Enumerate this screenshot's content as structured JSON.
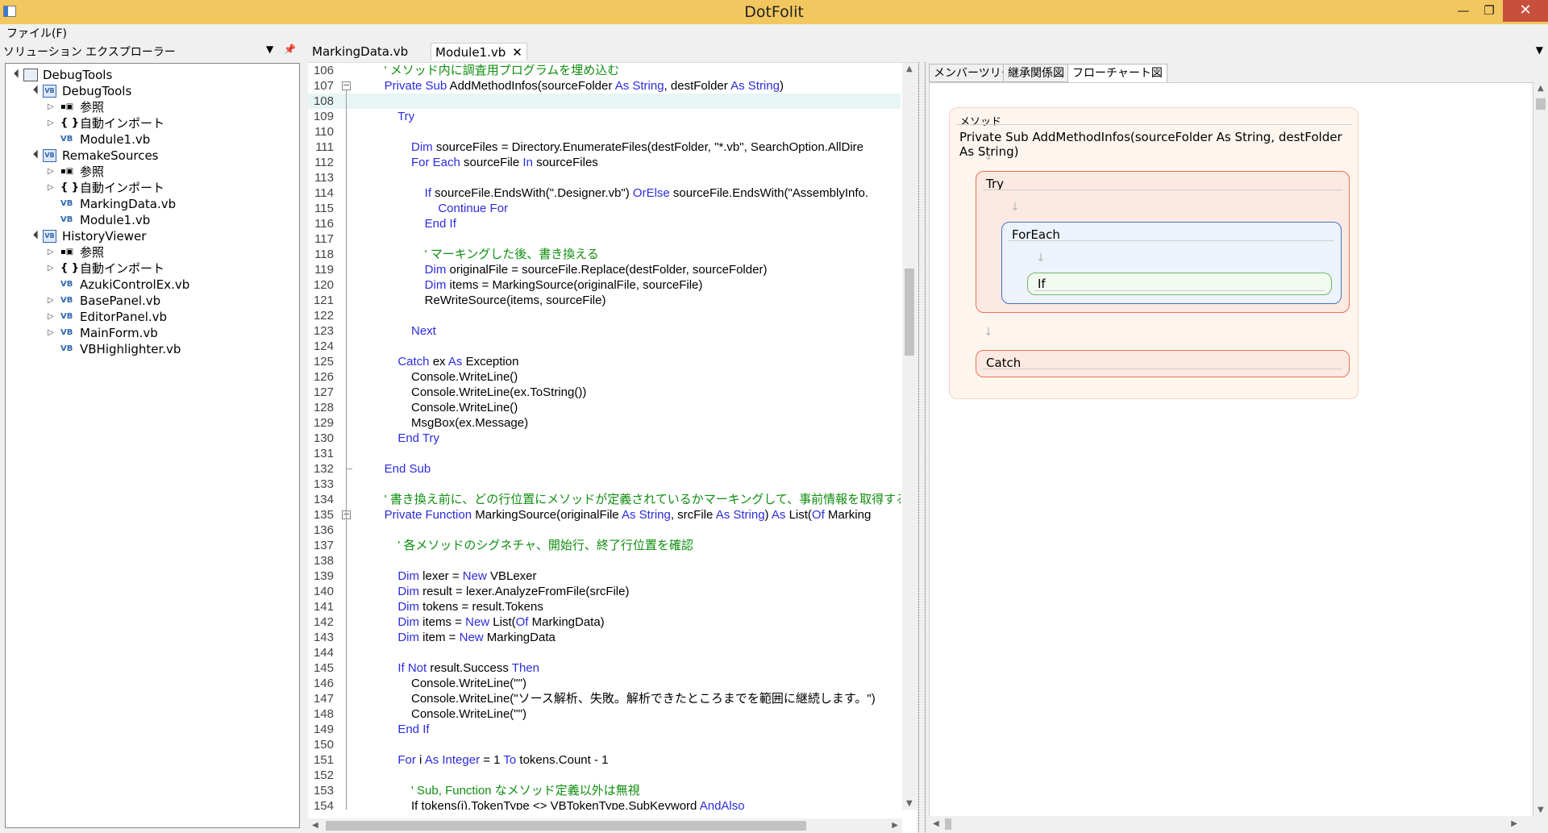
{
  "window": {
    "title": "DotFolit",
    "minimize": "—",
    "maximize": "❐",
    "close": "✕"
  },
  "menu": {
    "file": "ファイル(F)"
  },
  "explorer": {
    "title": "ソリューション エクスプローラー",
    "dropdown_icon": "▼",
    "pin_icon": "📌",
    "nodes": [
      {
        "label": "DebugTools",
        "icon": "solution-icon"
      },
      {
        "label": "DebugTools",
        "icon": "vb-project-icon"
      },
      {
        "label": "参照",
        "icon": "references-icon"
      },
      {
        "label": "自動インポート",
        "icon": "braces-icon"
      },
      {
        "label": "Module1.vb",
        "icon": "vb-file-icon"
      },
      {
        "label": "RemakeSources",
        "icon": "vb-project-icon"
      },
      {
        "label": "参照",
        "icon": "references-icon"
      },
      {
        "label": "自動インポート",
        "icon": "braces-icon"
      },
      {
        "label": "MarkingData.vb",
        "icon": "vb-file-icon"
      },
      {
        "label": "Module1.vb",
        "icon": "vb-file-icon"
      },
      {
        "label": "HistoryViewer",
        "icon": "vb-project-icon"
      },
      {
        "label": "参照",
        "icon": "references-icon"
      },
      {
        "label": "自動インポート",
        "icon": "braces-icon"
      },
      {
        "label": "AzukiControlEx.vb",
        "icon": "vb-file-icon"
      },
      {
        "label": "BasePanel.vb",
        "icon": "vb-file-icon"
      },
      {
        "label": "EditorPanel.vb",
        "icon": "vb-file-icon"
      },
      {
        "label": "MainForm.vb",
        "icon": "vb-file-icon"
      },
      {
        "label": "VBHighlighter.vb",
        "icon": "vb-file-icon"
      }
    ]
  },
  "doc_tabs": [
    {
      "label": "MarkingData.vb"
    },
    {
      "label": "Module1.vb",
      "close": "✕"
    }
  ],
  "code_lines": [
    {
      "num": "106",
      "code": [
        [
          "cm",
          "    ' メソッド内に調査用プログラムを埋め込む"
        ]
      ]
    },
    {
      "num": "107",
      "code": [
        [
          "kw",
          "    Private Sub"
        ],
        [
          "",
          " AddMethodInfos(sourceFolder "
        ],
        [
          "kw",
          "As String"
        ],
        [
          "",
          ", destFolder "
        ],
        [
          "kw",
          "As String"
        ],
        [
          "",
          ")"
        ]
      ]
    },
    {
      "num": "108",
      "code": []
    },
    {
      "num": "109",
      "code": [
        [
          "kw",
          "        Try"
        ]
      ]
    },
    {
      "num": "110",
      "code": []
    },
    {
      "num": "111",
      "code": [
        [
          "kw",
          "            Dim"
        ],
        [
          "",
          " sourceFiles = Directory.EnumerateFiles(destFolder, \"*.vb\", SearchOption.AllDire"
        ]
      ]
    },
    {
      "num": "112",
      "code": [
        [
          "kw",
          "            For Each"
        ],
        [
          "",
          " sourceFile "
        ],
        [
          "kw",
          "In"
        ],
        [
          "",
          " sourceFiles"
        ]
      ]
    },
    {
      "num": "113",
      "code": []
    },
    {
      "num": "114",
      "code": [
        [
          "kw",
          "                If"
        ],
        [
          "",
          " sourceFile.EndsWith(\".Designer.vb\") "
        ],
        [
          "kw",
          "OrElse"
        ],
        [
          "",
          " sourceFile.EndsWith(\"AssemblyInfo."
        ]
      ]
    },
    {
      "num": "115",
      "code": [
        [
          "kw",
          "                    Continue For"
        ]
      ]
    },
    {
      "num": "116",
      "code": [
        [
          "kw",
          "                End If"
        ]
      ]
    },
    {
      "num": "117",
      "code": []
    },
    {
      "num": "118",
      "code": [
        [
          "cm",
          "                ' マーキングした後、書き換える"
        ]
      ]
    },
    {
      "num": "119",
      "code": [
        [
          "kw",
          "                Dim"
        ],
        [
          "",
          " originalFile = sourceFile.Replace(destFolder, sourceFolder)"
        ]
      ]
    },
    {
      "num": "120",
      "code": [
        [
          "kw",
          "                Dim"
        ],
        [
          "",
          " items = MarkingSource(originalFile, sourceFile)"
        ]
      ]
    },
    {
      "num": "121",
      "code": [
        [
          "",
          "                ReWriteSource(items, sourceFile)"
        ]
      ]
    },
    {
      "num": "122",
      "code": []
    },
    {
      "num": "123",
      "code": [
        [
          "kw",
          "            Next"
        ]
      ]
    },
    {
      "num": "124",
      "code": []
    },
    {
      "num": "125",
      "code": [
        [
          "kw",
          "        Catch"
        ],
        [
          "",
          " ex "
        ],
        [
          "kw",
          "As"
        ],
        [
          "",
          " Exception"
        ]
      ]
    },
    {
      "num": "126",
      "code": [
        [
          "",
          "            Console.WriteLine()"
        ]
      ]
    },
    {
      "num": "127",
      "code": [
        [
          "",
          "            Console.WriteLine(ex.ToString())"
        ]
      ]
    },
    {
      "num": "128",
      "code": [
        [
          "",
          "            Console.WriteLine()"
        ]
      ]
    },
    {
      "num": "129",
      "code": [
        [
          "",
          "            MsgBox(ex.Message)"
        ]
      ]
    },
    {
      "num": "130",
      "code": [
        [
          "kw",
          "        End Try"
        ]
      ]
    },
    {
      "num": "131",
      "code": []
    },
    {
      "num": "132",
      "code": [
        [
          "kw",
          "    End Sub"
        ]
      ]
    },
    {
      "num": "133",
      "code": []
    },
    {
      "num": "134",
      "code": [
        [
          "cm",
          "    ' 書き換え前に、どの行位置にメソッドが定義されているかマーキングして、事前情報を取得する"
        ]
      ]
    },
    {
      "num": "135",
      "code": [
        [
          "kw",
          "    Private Function"
        ],
        [
          "",
          " MarkingSource(originalFile "
        ],
        [
          "kw",
          "As String"
        ],
        [
          "",
          ", srcFile "
        ],
        [
          "kw",
          "As String"
        ],
        [
          "",
          ") "
        ],
        [
          "kw",
          "As"
        ],
        [
          "",
          " List("
        ],
        [
          "kw",
          "Of"
        ],
        [
          "",
          " Marking"
        ]
      ]
    },
    {
      "num": "136",
      "code": []
    },
    {
      "num": "137",
      "code": [
        [
          "cm",
          "        ' 各メソッドのシグネチャ、開始行、終了行位置を確認"
        ]
      ]
    },
    {
      "num": "138",
      "code": []
    },
    {
      "num": "139",
      "code": [
        [
          "kw",
          "        Dim"
        ],
        [
          "",
          " lexer = "
        ],
        [
          "kw",
          "New"
        ],
        [
          "",
          " VBLexer"
        ]
      ]
    },
    {
      "num": "140",
      "code": [
        [
          "kw",
          "        Dim"
        ],
        [
          "",
          " result = lexer.AnalyzeFromFile(srcFile)"
        ]
      ]
    },
    {
      "num": "141",
      "code": [
        [
          "kw",
          "        Dim"
        ],
        [
          "",
          " tokens = result.Tokens"
        ]
      ]
    },
    {
      "num": "142",
      "code": [
        [
          "kw",
          "        Dim"
        ],
        [
          "",
          " items = "
        ],
        [
          "kw",
          "New"
        ],
        [
          "",
          " List("
        ],
        [
          "kw",
          "Of"
        ],
        [
          "",
          " MarkingData)"
        ]
      ]
    },
    {
      "num": "143",
      "code": [
        [
          "kw",
          "        Dim"
        ],
        [
          "",
          " item = "
        ],
        [
          "kw",
          "New"
        ],
        [
          "",
          " MarkingData"
        ]
      ]
    },
    {
      "num": "144",
      "code": []
    },
    {
      "num": "145",
      "code": [
        [
          "kw",
          "        If Not"
        ],
        [
          "",
          " result.Success "
        ],
        [
          "kw",
          "Then"
        ]
      ]
    },
    {
      "num": "146",
      "code": [
        [
          "",
          "            Console.WriteLine(\"\")"
        ]
      ]
    },
    {
      "num": "147",
      "code": [
        [
          "",
          "            Console.WriteLine(\"ソース解析、失敗。解析できたところまでを範囲に継続します。\")"
        ]
      ]
    },
    {
      "num": "148",
      "code": [
        [
          "",
          "            Console.WriteLine(\"\")"
        ]
      ]
    },
    {
      "num": "149",
      "code": [
        [
          "kw",
          "        End If"
        ]
      ]
    },
    {
      "num": "150",
      "code": []
    },
    {
      "num": "151",
      "code": [
        [
          "kw",
          "        For"
        ],
        [
          "",
          " i "
        ],
        [
          "kw",
          "As Integer"
        ],
        [
          "",
          " = 1 "
        ],
        [
          "kw",
          "To"
        ],
        [
          "",
          " tokens.Count - 1"
        ]
      ]
    },
    {
      "num": "152",
      "code": []
    },
    {
      "num": "153",
      "code": [
        [
          "cm",
          "            ' Sub, Function なメソッド定義以外は無視"
        ]
      ]
    },
    {
      "num": "154",
      "code": [
        [
          "",
          "            If tokens(i).TokenType <> VBTokenType.SubKeyword "
        ],
        [
          "kw",
          "AndAlso"
        ]
      ]
    }
  ],
  "right_tabs": [
    {
      "label": "メンバーツリー"
    },
    {
      "label": "継承関係図"
    },
    {
      "label": "フローチャート図"
    }
  ],
  "flowchart": {
    "method_label": "メソッド",
    "method_signature": "Private Sub AddMethodInfos(sourceFolder As String, destFolder As String)",
    "try_label": "Try",
    "foreach_label": "ForEach",
    "if_label": "If",
    "catch_label": "Catch",
    "arrow": "↓"
  },
  "colors": {
    "titlebar": "#f3c75f",
    "keyword": "#2c2cdc",
    "comment": "#118e11",
    "try_border": "#e8734e",
    "foreach_border": "#4472c4",
    "if_border": "#70b86a"
  }
}
